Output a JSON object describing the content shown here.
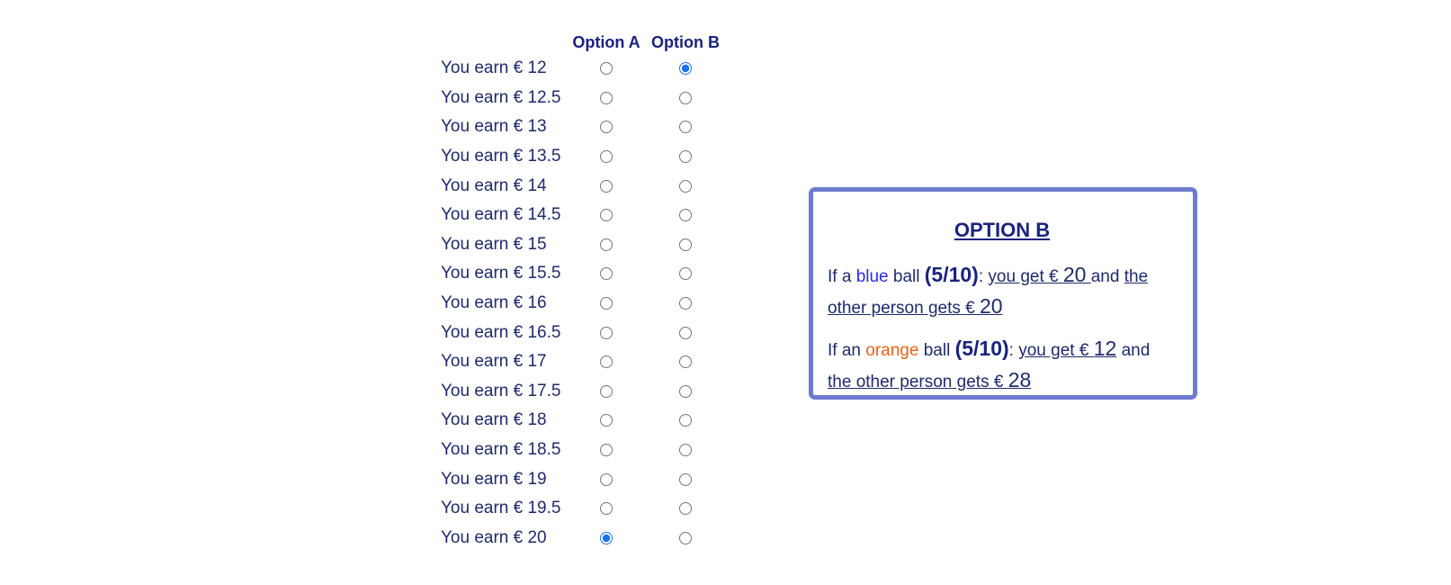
{
  "table": {
    "header_a": "Option A",
    "header_b": "Option B",
    "rows": [
      {
        "label": "You earn € 12",
        "selected": "B"
      },
      {
        "label": "You earn € 12.5",
        "selected": ""
      },
      {
        "label": "You earn € 13",
        "selected": ""
      },
      {
        "label": "You earn € 13.5",
        "selected": ""
      },
      {
        "label": "You earn € 14",
        "selected": ""
      },
      {
        "label": "You earn € 14.5",
        "selected": ""
      },
      {
        "label": "You earn € 15",
        "selected": ""
      },
      {
        "label": "You earn € 15.5",
        "selected": ""
      },
      {
        "label": "You earn € 16",
        "selected": ""
      },
      {
        "label": "You earn € 16.5",
        "selected": ""
      },
      {
        "label": "You earn € 17",
        "selected": ""
      },
      {
        "label": "You earn € 17.5",
        "selected": ""
      },
      {
        "label": "You earn € 18",
        "selected": ""
      },
      {
        "label": "You earn € 18.5",
        "selected": ""
      },
      {
        "label": "You earn € 19",
        "selected": ""
      },
      {
        "label": "You earn € 19.5",
        "selected": ""
      },
      {
        "label": "You earn € 20",
        "selected": "A"
      }
    ]
  },
  "option_box": {
    "title": "OPTION B",
    "outcome1": {
      "if_a": "If a",
      "color_word": "blue",
      "ball": "ball",
      "prob": "(5/10)",
      "colon": ":",
      "you_get_prefix": "you get € ",
      "you_get_value": "20",
      "and": "and",
      "other_prefix": "the other person gets € ",
      "other_value": "20"
    },
    "outcome2": {
      "if_a": "If an",
      "color_word": "orange",
      "ball": "ball",
      "prob": "(5/10)",
      "colon": ":",
      "you_get_prefix": "you get € ",
      "you_get_value": "12",
      "and": "and",
      "other_prefix": "the other person gets € ",
      "other_value": "28"
    }
  },
  "colors": {
    "text": "#1f2a6b",
    "heading": "#1a237e",
    "box_border": "#6d7bd0",
    "blue_word": "#2a2ae8",
    "orange_word": "#e8641a",
    "radio_selected": "#1a73e8"
  }
}
